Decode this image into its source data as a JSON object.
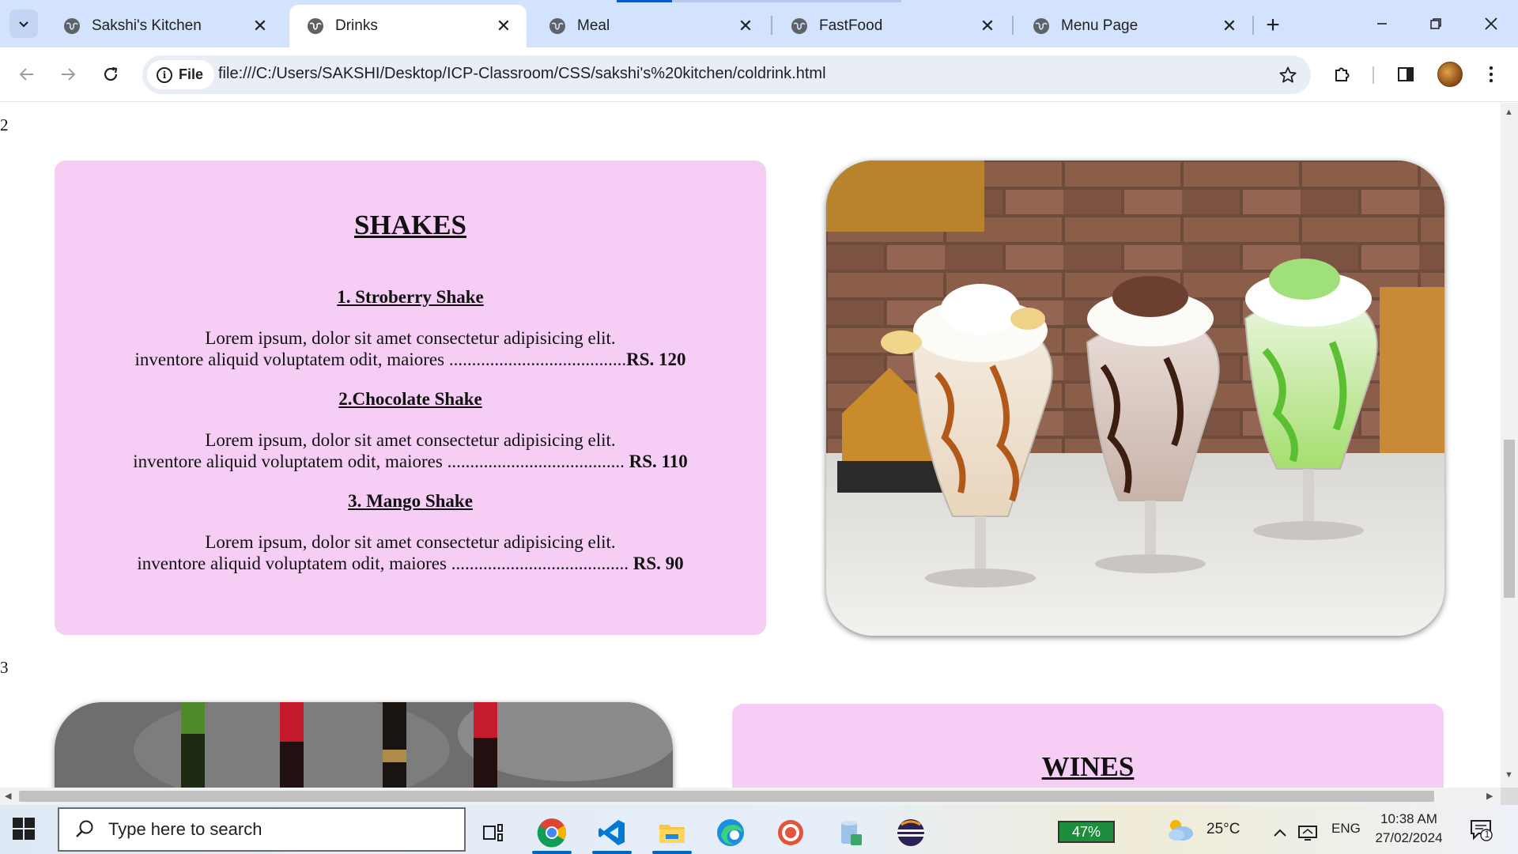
{
  "browser": {
    "tabs": [
      {
        "title": "Sakshi's Kitchen",
        "active": false
      },
      {
        "title": "Drinks",
        "active": true
      },
      {
        "title": "Meal",
        "active": false
      },
      {
        "title": "FastFood",
        "active": false
      },
      {
        "title": "Menu Page",
        "active": false
      }
    ],
    "tab_close": "✕",
    "new_tab": "+",
    "site_chip": "File",
    "url": "file:///C:/Users/SAKSHI/Desktop/ICP-Classroom/CSS/sakshi's%20kitchen/coldrink.html"
  },
  "page": {
    "section2_number": "2",
    "section3_number": "3",
    "shakes": {
      "heading": "SHAKES",
      "items": [
        {
          "title": "1. Stroberry Shake",
          "line1": "Lorem ipsum, dolor sit amet consectetur adipisicing elit.",
          "line2": "inventore aliquid voluptatem odit, maiores .......................................",
          "price": "RS. 120"
        },
        {
          "title": "2.Chocolate Shake",
          "line1": "Lorem ipsum, dolor sit amet consectetur adipisicing elit.",
          "line2": "inventore aliquid voluptatem odit, maiores .......................................",
          "price": " RS. 110"
        },
        {
          "title": "3. Mango Shake",
          "line1": "Lorem ipsum, dolor sit amet consectetur adipisicing elit.",
          "line2": "inventore aliquid voluptatem odit, maiores .......................................",
          "price": " RS. 90"
        }
      ]
    },
    "wines": {
      "heading": "WINES"
    }
  },
  "taskbar": {
    "search_placeholder": "Type here to search",
    "battery": "47%",
    "temperature": "25°C",
    "language": "ENG",
    "time": "10:38 AM",
    "date": "27/02/2024",
    "notification_count": "1"
  },
  "colors": {
    "card_pink": "#f5cdf5",
    "tabstrip": "#d3e3fd",
    "accent": "#0b57d0"
  }
}
